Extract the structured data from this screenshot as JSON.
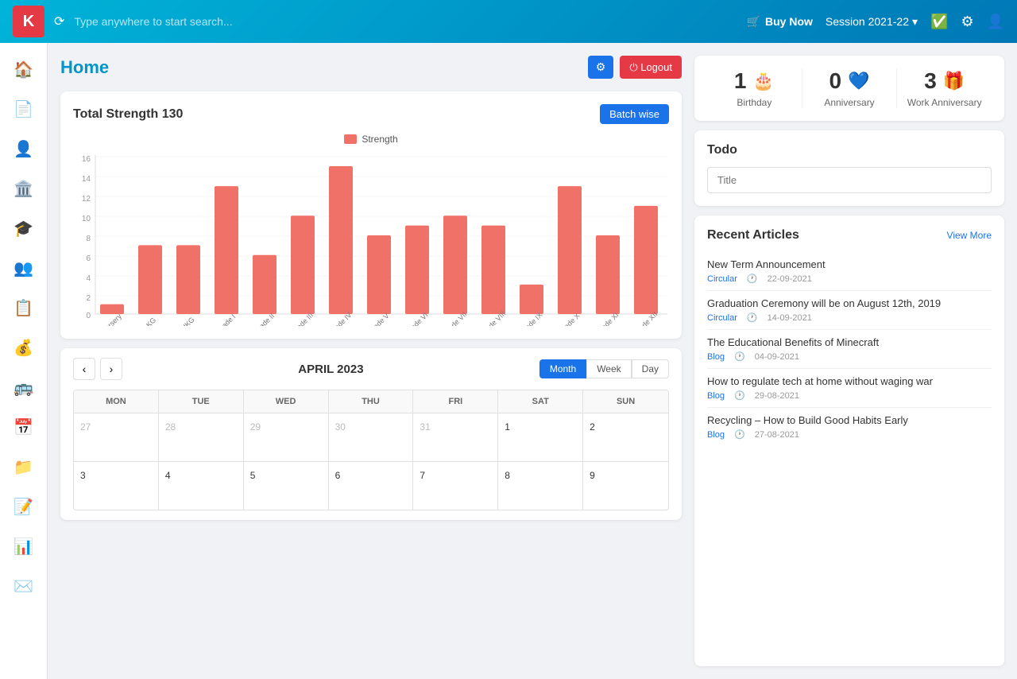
{
  "topnav": {
    "logo": "K",
    "search_placeholder": "Type anywhere to start search...",
    "buy_now": "Buy Now",
    "session": "Session 2021-22",
    "session_icon": "▾"
  },
  "page": {
    "title": "Home",
    "gear_label": "⚙",
    "logout_label": "⏻ Logout"
  },
  "chart": {
    "title": "Total Strength 130",
    "batch_btn": "Batch wise",
    "legend_label": "Strength",
    "y_labels": [
      "0",
      "2",
      "4",
      "6",
      "8",
      "10",
      "12",
      "14",
      "16"
    ],
    "bars": [
      {
        "label": "Nursery",
        "value": 1
      },
      {
        "label": "LKG",
        "value": 7
      },
      {
        "label": "UKG",
        "value": 7
      },
      {
        "label": "Grade I",
        "value": 13
      },
      {
        "label": "Grade II",
        "value": 6
      },
      {
        "label": "Grade III",
        "value": 10
      },
      {
        "label": "Grade IV",
        "value": 15
      },
      {
        "label": "Grade V",
        "value": 8
      },
      {
        "label": "Grade VI",
        "value": 9
      },
      {
        "label": "Grade VII",
        "value": 10
      },
      {
        "label": "Grade VIII",
        "value": 9
      },
      {
        "label": "Grade IX",
        "value": 3
      },
      {
        "label": "Grade X",
        "value": 13
      },
      {
        "label": "Grade XI",
        "value": 8
      },
      {
        "label": "Grade XII",
        "value": 11
      }
    ],
    "max_value": 16
  },
  "calendar": {
    "month_title": "APRIL 2023",
    "view_btns": [
      "Month",
      "Week",
      "Day"
    ],
    "active_view": "Month",
    "day_headers": [
      "MON",
      "TUE",
      "WED",
      "THU",
      "FRI",
      "SAT",
      "SUN"
    ],
    "weeks": [
      [
        {
          "date": "27",
          "other": true
        },
        {
          "date": "28",
          "other": true
        },
        {
          "date": "29",
          "other": true
        },
        {
          "date": "30",
          "other": true
        },
        {
          "date": "31",
          "other": true
        },
        {
          "date": "1",
          "other": false
        },
        {
          "date": "2",
          "other": false
        }
      ],
      [
        {
          "date": "3",
          "other": false
        },
        {
          "date": "4",
          "other": false
        },
        {
          "date": "5",
          "other": false
        },
        {
          "date": "6",
          "other": false
        },
        {
          "date": "7",
          "other": false
        },
        {
          "date": "8",
          "other": false
        },
        {
          "date": "9",
          "other": false
        }
      ]
    ]
  },
  "stats": {
    "birthday": {
      "count": "1",
      "icon": "🎂",
      "label": "Birthday"
    },
    "anniversary": {
      "count": "0",
      "icon": "💙",
      "label": "Anniversary"
    },
    "work_anniversary": {
      "count": "3",
      "icon": "🎁",
      "label": "Work Anniversary"
    }
  },
  "todo": {
    "title": "Todo",
    "placeholder": "Title"
  },
  "articles": {
    "title": "Recent Articles",
    "view_more": "View More",
    "items": [
      {
        "title": "New Term Announcement",
        "tag": "Circular",
        "date": "22-09-2021"
      },
      {
        "title": "Graduation Ceremony will be on August 12th, 2019",
        "tag": "Circular",
        "date": "14-09-2021"
      },
      {
        "title": "The Educational Benefits of Minecraft",
        "tag": "Blog",
        "date": "04-09-2021"
      },
      {
        "title": "How to regulate tech at home without waging war",
        "tag": "Blog",
        "date": "29-08-2021"
      },
      {
        "title": "Recycling – How to Build Good Habits Early",
        "tag": "Blog",
        "date": "27-08-2021"
      }
    ]
  },
  "sidebar": {
    "items": [
      {
        "icon": "🏠",
        "name": "home"
      },
      {
        "icon": "📄",
        "name": "document"
      },
      {
        "icon": "👤",
        "name": "person"
      },
      {
        "icon": "🏛️",
        "name": "institution"
      },
      {
        "icon": "🎓",
        "name": "graduation"
      },
      {
        "icon": "👥",
        "name": "staff"
      },
      {
        "icon": "📋",
        "name": "list"
      },
      {
        "icon": "💰",
        "name": "finance"
      },
      {
        "icon": "🚌",
        "name": "transport"
      },
      {
        "icon": "📅",
        "name": "calendar"
      },
      {
        "icon": "📁",
        "name": "folder"
      },
      {
        "icon": "📝",
        "name": "notes"
      },
      {
        "icon": "📊",
        "name": "reports"
      },
      {
        "icon": "✉️",
        "name": "mail"
      }
    ]
  }
}
